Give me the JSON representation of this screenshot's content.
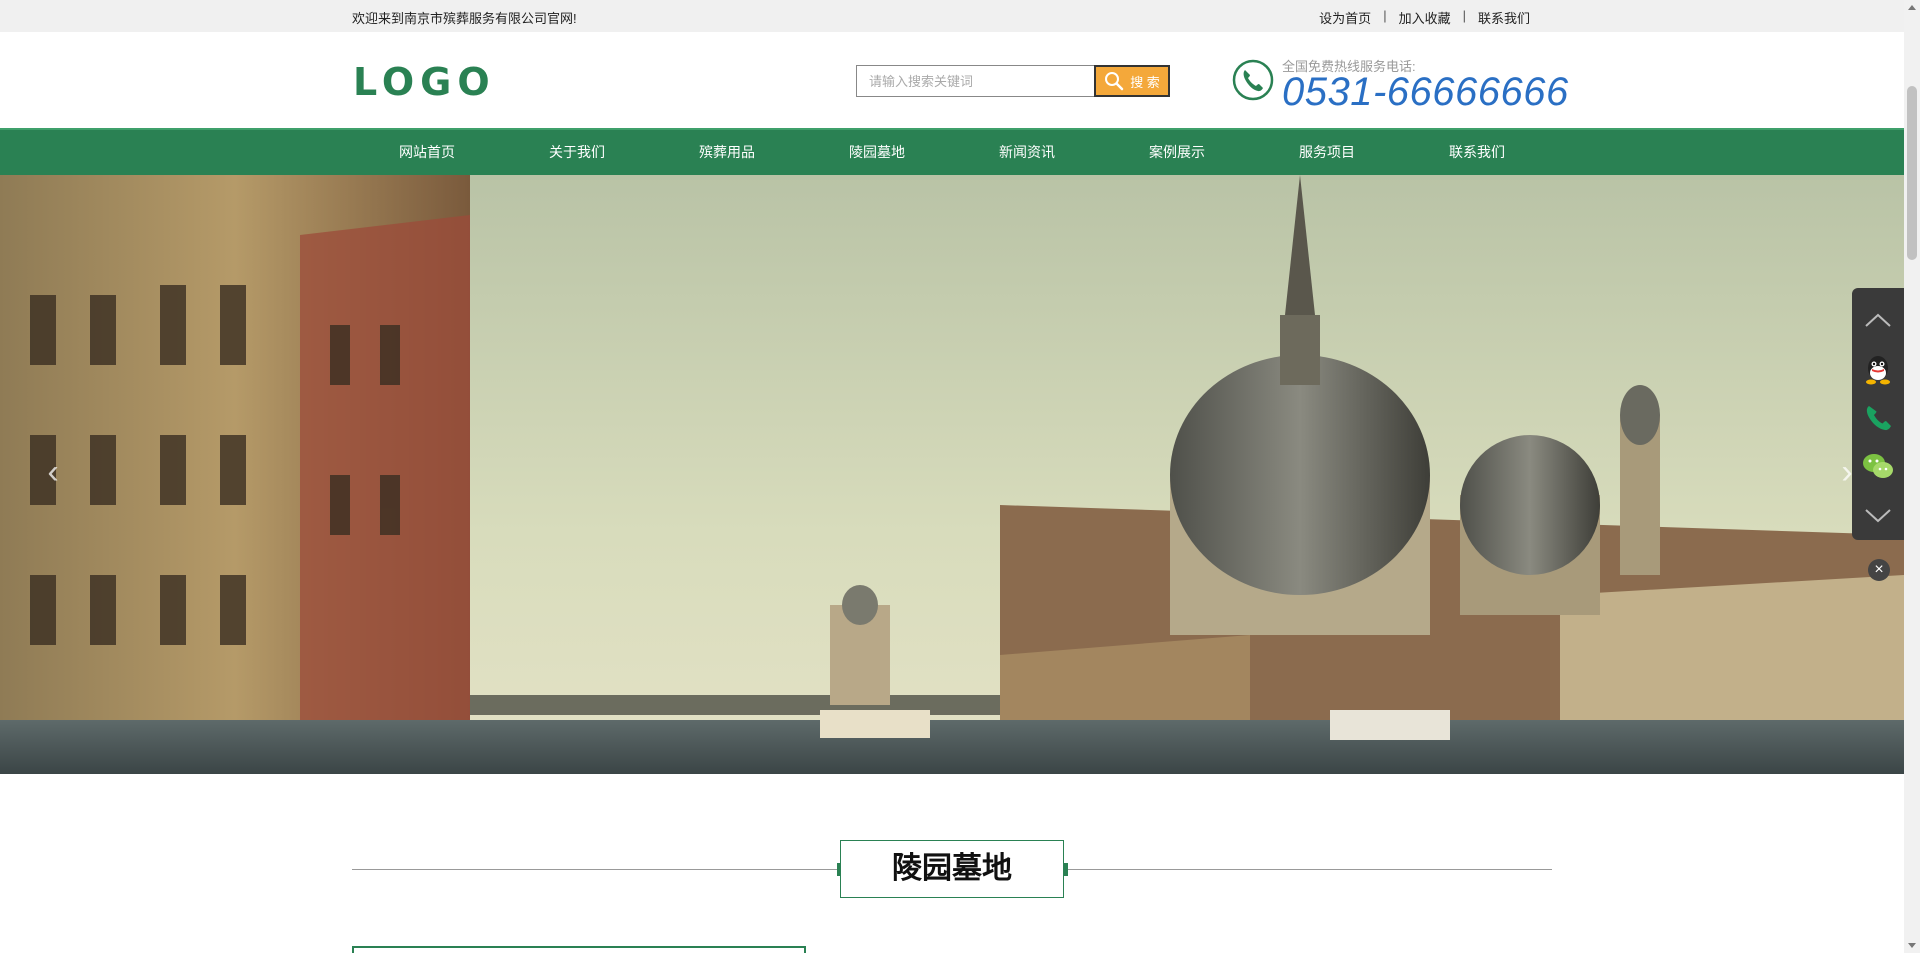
{
  "topbar": {
    "welcome": "欢迎来到南京市殡葬服务有限公司官网!",
    "links": [
      "设为首页",
      "加入收藏",
      "联系我们"
    ],
    "separator": "|"
  },
  "header": {
    "logo": "LOGO",
    "search": {
      "placeholder": "请输入搜索关键词",
      "button_label": "搜 索"
    },
    "hotline": {
      "label": "全国免费热线服务电话:",
      "number": "0531-66666666"
    }
  },
  "nav": {
    "items": [
      "网站首页",
      "关于我们",
      "殡葬用品",
      "陵园墓地",
      "新闻资讯",
      "案例展示",
      "服务项目",
      "联系我们"
    ]
  },
  "banner": {
    "prev_icon": "‹",
    "next_icon": "›"
  },
  "section": {
    "title": "陵园墓地"
  },
  "sidebar": {
    "icons": [
      "chevron-up-icon",
      "qq-icon",
      "phone-icon",
      "wechat-icon",
      "chevron-down-icon"
    ],
    "close_label": "×"
  },
  "colors": {
    "brand_green": "#2a8153",
    "search_orange": "#f4a83a",
    "hotline_blue": "#2a6fc4"
  }
}
